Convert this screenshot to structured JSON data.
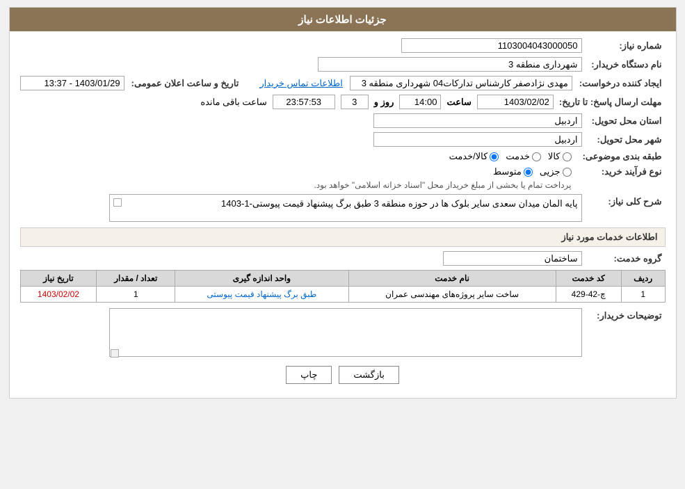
{
  "header": {
    "title": "جزئیات اطلاعات نیاز"
  },
  "form": {
    "need_number_label": "شماره نیاز:",
    "need_number_value": "1103004043000050",
    "buyer_org_label": "نام دستگاه خریدار:",
    "buyer_org_value": "شهرداری منطقه 3",
    "creator_label": "ایجاد کننده درخواست:",
    "creator_value": "مهدی نژادصفر کارشناس تداركات04 شهرداری منطقه 3",
    "creator_link": "اطلاعات تماس خریدار",
    "send_date_label": "مهلت ارسال پاسخ: تا تاریخ:",
    "announce_date_label": "تاریخ و ساعت اعلان عمومی:",
    "announce_date_value": "1403/01/29 - 13:37",
    "deadline_date": "1403/02/02",
    "deadline_time": "14:00",
    "deadline_days": "3",
    "deadline_remaining": "23:57:53",
    "deadline_days_label": "روز و",
    "deadline_remaining_label": "ساعت باقی مانده",
    "province_label": "استان محل تحویل:",
    "province_value": "اردبیل",
    "city_label": "شهر محل تحویل:",
    "city_value": "اردبیل",
    "category_label": "طبقه بندی موضوعی:",
    "category_kala": "کالا",
    "category_khedmat": "خدمت",
    "category_kala_khedmat": "کالا/خدمت",
    "process_label": "نوع فرآیند خرید:",
    "process_jozvi": "جزیی",
    "process_motavaset": "متوسط",
    "process_note": "پرداخت تمام یا بخشی از مبلغ خریداز محل \"اسناد خزانه اسلامی\" خواهد بود.",
    "need_desc_label": "شرح کلی نیاز:",
    "need_desc_value": "پایه المان میدان سعدی سایر بلوک ها در حوزه منطقه 3 طبق برگ پیشنهاد قیمت پیوستی-1-1403",
    "services_info_label": "اطلاعات خدمات مورد نیاز",
    "service_group_label": "گروه خدمت:",
    "service_group_value": "ساختمان",
    "table": {
      "col_radif": "ردیف",
      "col_code": "کد خدمت",
      "col_name": "نام خدمت",
      "col_unit": "واحد اندازه گیری",
      "col_count": "تعداد / مقدار",
      "col_date": "تاریخ نیاز",
      "rows": [
        {
          "radif": "1",
          "code": "چ-42-429",
          "name": "ساخت سایر پروژه‌های مهندسی عمران",
          "unit": "طبق برگ پیشنهاد قیمت پیوستی",
          "count": "1",
          "date": "1403/02/02"
        }
      ]
    },
    "buyer_notes_label": "توضیحات خریدار:",
    "buyer_notes_value": "",
    "btn_back": "بازگشت",
    "btn_print": "چاپ"
  }
}
